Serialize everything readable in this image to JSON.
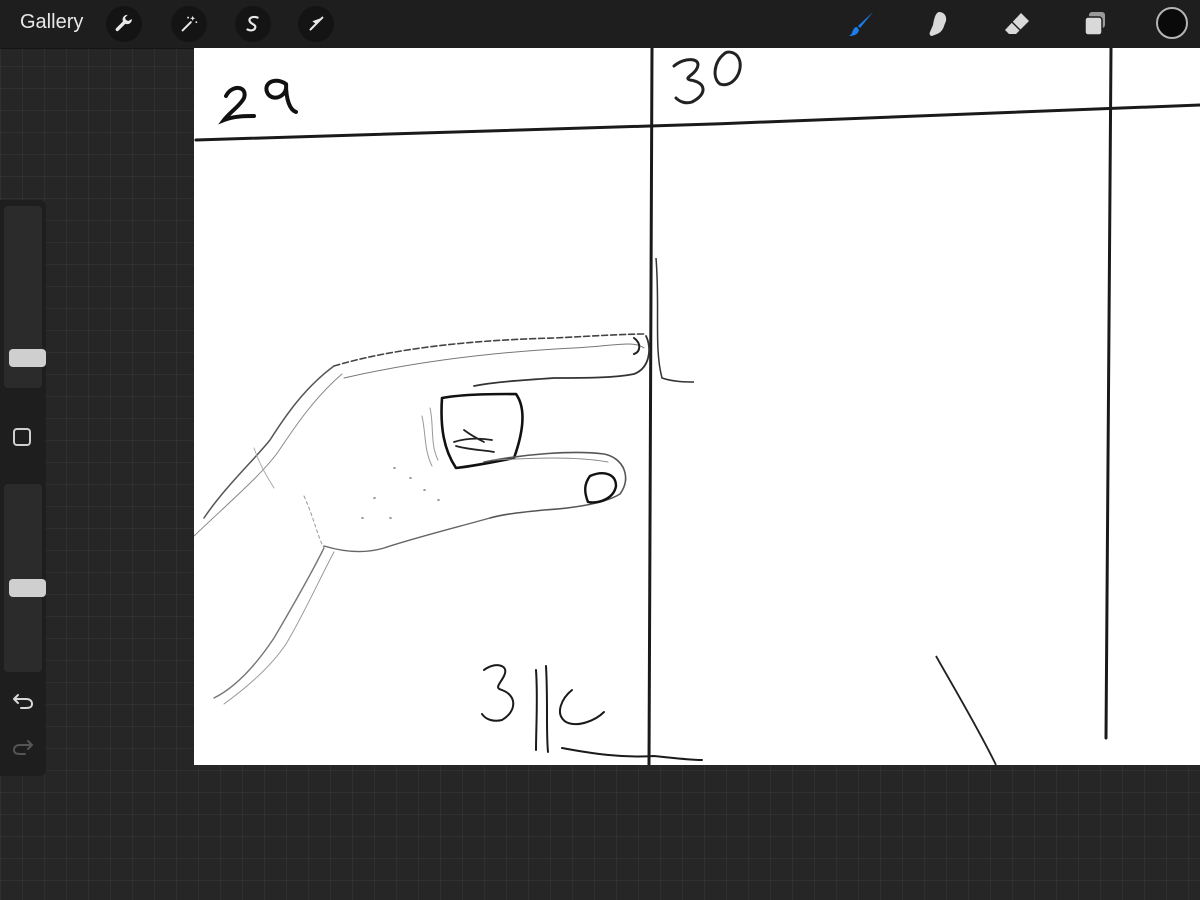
{
  "toolbar": {
    "gallery_label": "Gallery",
    "left_tools": [
      {
        "name": "actions",
        "icon": "wrench-icon"
      },
      {
        "name": "adjustments",
        "icon": "magic-wand-icon"
      },
      {
        "name": "selection",
        "icon": "selection-s-icon"
      },
      {
        "name": "transform",
        "icon": "arrow-cursor-icon"
      }
    ],
    "right_tools": [
      {
        "name": "brush",
        "icon": "brush-icon",
        "active": true
      },
      {
        "name": "smudge",
        "icon": "smudge-icon",
        "active": false
      },
      {
        "name": "eraser",
        "icon": "eraser-icon",
        "active": false
      },
      {
        "name": "layers",
        "icon": "layers-icon",
        "active": false
      }
    ],
    "current_color": "#0a0a0a",
    "active_color": "#1a7ef0"
  },
  "sidebar": {
    "brush_size_level": 0.12,
    "opacity_level": 0.44,
    "undo_icon": "undo-icon",
    "redo_icon": "redo-icon",
    "modify_icon": "square-icon"
  },
  "canvas": {
    "panel_labels": [
      "29",
      "30",
      "31"
    ],
    "sketch": "hand-pointing-icon"
  }
}
